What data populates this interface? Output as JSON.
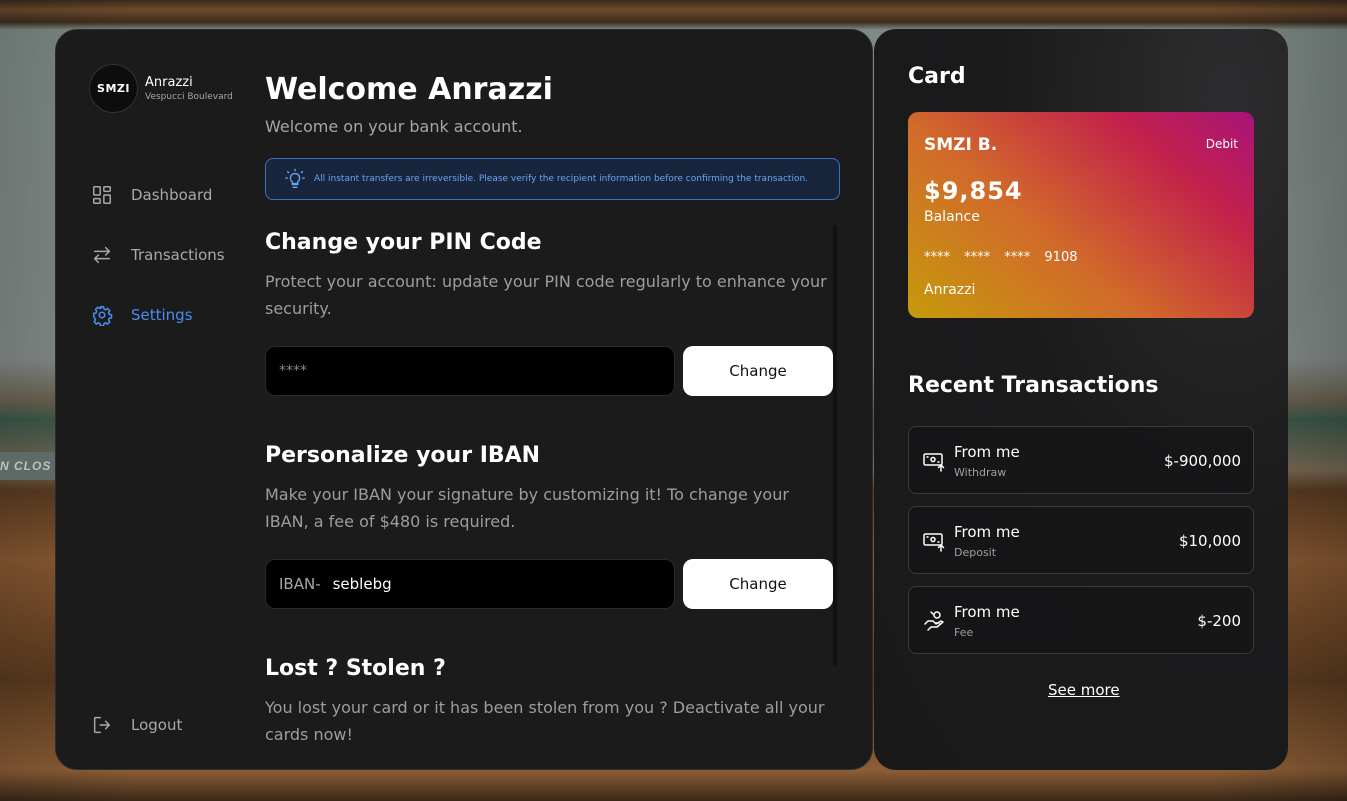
{
  "background": {
    "sign_text": "N CLOS"
  },
  "profile": {
    "avatar_text": "SMZI",
    "name": "Anrazzi",
    "location": "Vespucci Boulevard"
  },
  "sidebar": {
    "items": [
      {
        "label": "Dashboard",
        "icon": "dashboard-icon"
      },
      {
        "label": "Transactions",
        "icon": "transfer-arrows-icon"
      },
      {
        "label": "Settings",
        "icon": "gear-icon",
        "active": true
      }
    ],
    "logout_label": "Logout"
  },
  "main": {
    "title": "Welcome Anrazzi",
    "subtitle": "Welcome on your bank account.",
    "alert": "All instant transfers are irreversible. Please verify the recipient information before confirming the transaction.",
    "pin": {
      "title": "Change your PIN Code",
      "description": "Protect your account: update your PIN code regularly to enhance your security.",
      "placeholder": "****",
      "button": "Change"
    },
    "iban": {
      "title": "Personalize your IBAN",
      "description": "Make your IBAN your signature by customizing it! To change your IBAN, a fee of $480 is required.",
      "prefix": "IBAN-",
      "value": "seblebg",
      "button": "Change"
    },
    "lost": {
      "title": "Lost ? Stolen ?",
      "description": "You lost your card or it has been stolen from you ? Deactivate all your cards now!"
    }
  },
  "card_panel": {
    "heading": "Card",
    "card": {
      "name": "SMZI B.",
      "type": "Debit",
      "balance": "$9,854",
      "balance_label": "Balance",
      "number": "**** **** **** 9108",
      "holder": "Anrazzi"
    },
    "recent_heading": "Recent Transactions",
    "transactions": [
      {
        "title": "From me",
        "type": "Withdraw",
        "amount": "$-900,000",
        "icon": "cash-withdraw-icon"
      },
      {
        "title": "From me",
        "type": "Deposit",
        "amount": "$10,000",
        "icon": "cash-deposit-icon"
      },
      {
        "title": "From me",
        "type": "Fee",
        "amount": "$-200",
        "icon": "hand-coin-icon"
      }
    ],
    "see_more": "See more"
  },
  "colors": {
    "accent": "#4a8df0",
    "panel": "#1b1b1c",
    "alert_bg": "#17253d"
  }
}
